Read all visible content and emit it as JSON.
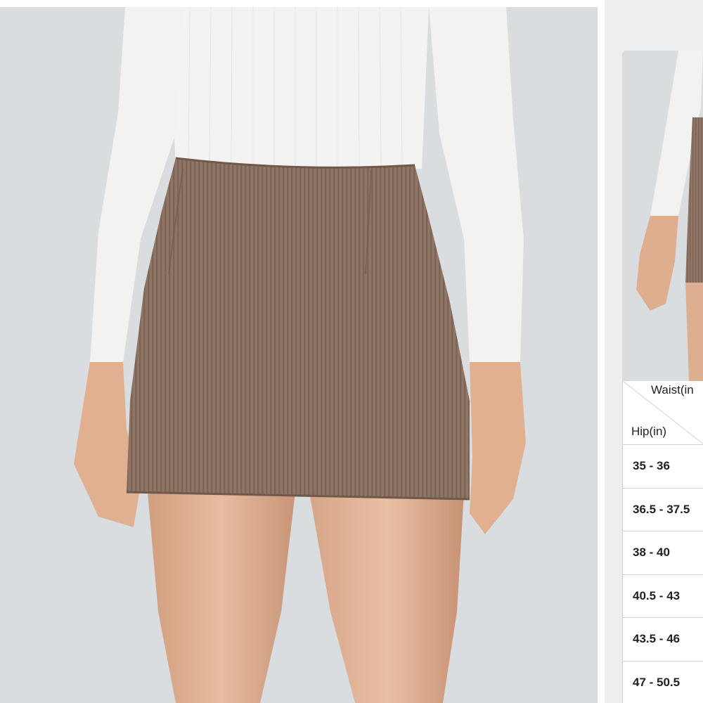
{
  "main_image": {
    "subject": "corduroy-mini-skirt",
    "colors": {
      "background": "#d9dde0",
      "skirt": "#8e7566",
      "top": "#f5f5f3",
      "skin": "#e3b79a"
    }
  },
  "side_panel": {
    "thumbnail": "skirt-model-thumbnail",
    "size_table": {
      "header_column": "Waist(in",
      "header_row": "Hip(in)",
      "rows": [
        "35 - 36",
        "36.5 - 37.5",
        "38 - 40",
        "40.5 - 43",
        "43.5 - 46",
        "47 - 50.5"
      ]
    }
  }
}
